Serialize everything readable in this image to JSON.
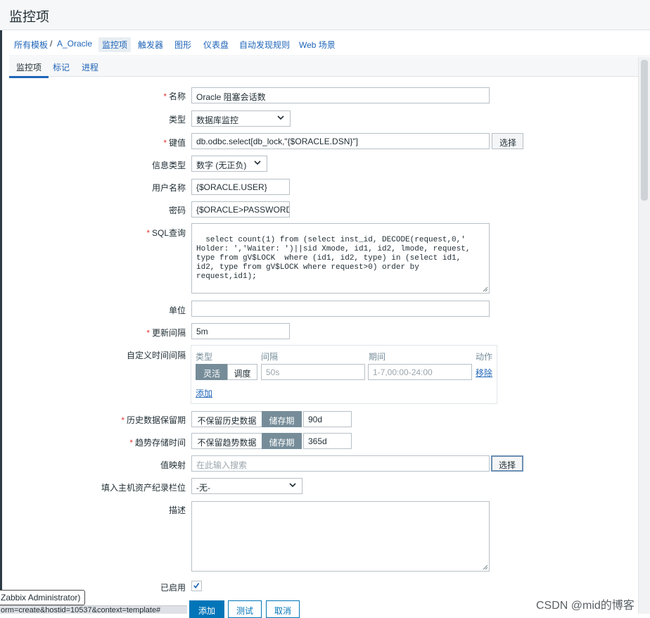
{
  "header": {
    "title": "监控项"
  },
  "breadcrumb": {
    "all_templates": "所有模板",
    "separator": "/",
    "template": "A_Oracle",
    "items": "监控项",
    "triggers": "触发器",
    "graphs": "图形",
    "dashboards": "仪表盘",
    "discovery": "自动发现规则",
    "web": "Web 场景"
  },
  "tabs": {
    "item": "监控项",
    "tags": "标记",
    "preprocessing": "进程"
  },
  "form": {
    "required_mark": "*",
    "name_label": "名称",
    "name_value": "Oracle 阻塞会话数",
    "type_label": "类型",
    "type_value": "数据库监控",
    "key_label": "键值",
    "key_value": "db.odbc.select[db_lock,\"{$ORACLE.DSN}\"]",
    "select_button": "选择",
    "info_type_label": "信息类型",
    "info_type_value": "数字 (无正负)",
    "username_label": "用户名称",
    "username_value": "{$ORACLE.USER}",
    "password_label": "密码",
    "password_value": "{$ORACLE>PASSWORD}",
    "sql_label": "SQL查询",
    "sql_value": "select count(1) from (select inst_id, DECODE(request,0,'\nHolder: ','Waiter: ')||sid Xmode, id1, id2, lmode, request,\ntype from gV$LOCK  where (id1, id2, type) in (select id1,\nid2, type from gV$LOCK where request>0) order by\nrequest,id1);",
    "units_label": "单位",
    "units_value": "",
    "interval_label": "更新间隔",
    "interval_value": "5m",
    "custom_intervals_label": "自定义时间间隔",
    "ci_type_header": "类型",
    "ci_interval_header": "间隔",
    "ci_period_header": "期间",
    "ci_action_header": "动作",
    "ci_flexible": "灵活",
    "ci_scheduling": "调度",
    "ci_interval_placeholder": "50s",
    "ci_period_placeholder": "1-7,00:00-24:00",
    "ci_remove": "移除",
    "ci_add": "添加",
    "history_label": "历史数据保留期",
    "history_no_keep": "不保留历史数据",
    "history_storage": "储存期",
    "history_value": "90d",
    "trends_label": "趋势存储时间",
    "trends_no_keep": "不保留趋势数据",
    "trends_storage": "储存期",
    "trends_value": "365d",
    "valuemap_label": "值映射",
    "valuemap_placeholder": "在此输入搜索",
    "valuemap_select": "选择",
    "inventory_label": "填入主机资产纪录栏位",
    "inventory_value": "-无-",
    "description_label": "描述",
    "description_value": "",
    "enabled_label": "已启用",
    "add_button": "添加",
    "test_button": "测试",
    "cancel_button": "取消"
  },
  "overlay": {
    "tooltip": "Zabbix Administrator)",
    "status_url": "orm=create&hostid=10537&context=template#",
    "csdn": "CSDN @mid的博客"
  },
  "colors": {
    "link": "#1f65b9",
    "primary": "#0275b8",
    "required": "#e33734",
    "segment_on": "#768d99"
  }
}
